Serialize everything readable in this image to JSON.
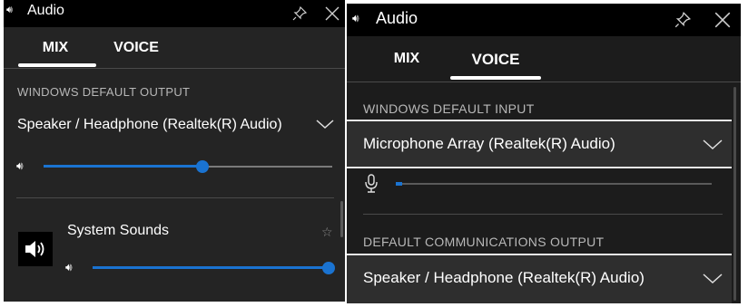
{
  "left_panel": {
    "title": "Audio",
    "tabs": [
      {
        "label": "MIX",
        "active": true
      },
      {
        "label": "VOICE",
        "active": false
      }
    ],
    "output_section_label": "WINDOWS DEFAULT OUTPUT",
    "output_device": "Speaker / Headphone (Realtek(R) Audio)",
    "master_volume": 0.55,
    "app": {
      "name": "System Sounds",
      "volume": 1.0,
      "icon": "speaker-icon",
      "favorite_icon": "star-icon"
    }
  },
  "right_panel": {
    "title": "Audio",
    "tabs": [
      {
        "label": "MIX",
        "active": false
      },
      {
        "label": "VOICE",
        "active": true
      }
    ],
    "input_section_label": "WINDOWS DEFAULT INPUT",
    "input_device": "Microphone Array (Realtek(R) Audio)",
    "input_level": 0.02,
    "comm_section_label": "DEFAULT COMMUNICATIONS OUTPUT",
    "comm_device": "Speaker / Headphone (Realtek(R) Audio)"
  },
  "icons": {
    "volume": "volume-icon",
    "pin": "pin-icon",
    "close": "close-icon",
    "chevron": "chevron-down-icon",
    "microphone": "microphone-icon"
  },
  "colors": {
    "accent": "#1a73d1",
    "titlebar": "#000000",
    "left_background": "#242424",
    "right_background": "#1c1c1c",
    "selected_row": "#2e2e2e"
  }
}
